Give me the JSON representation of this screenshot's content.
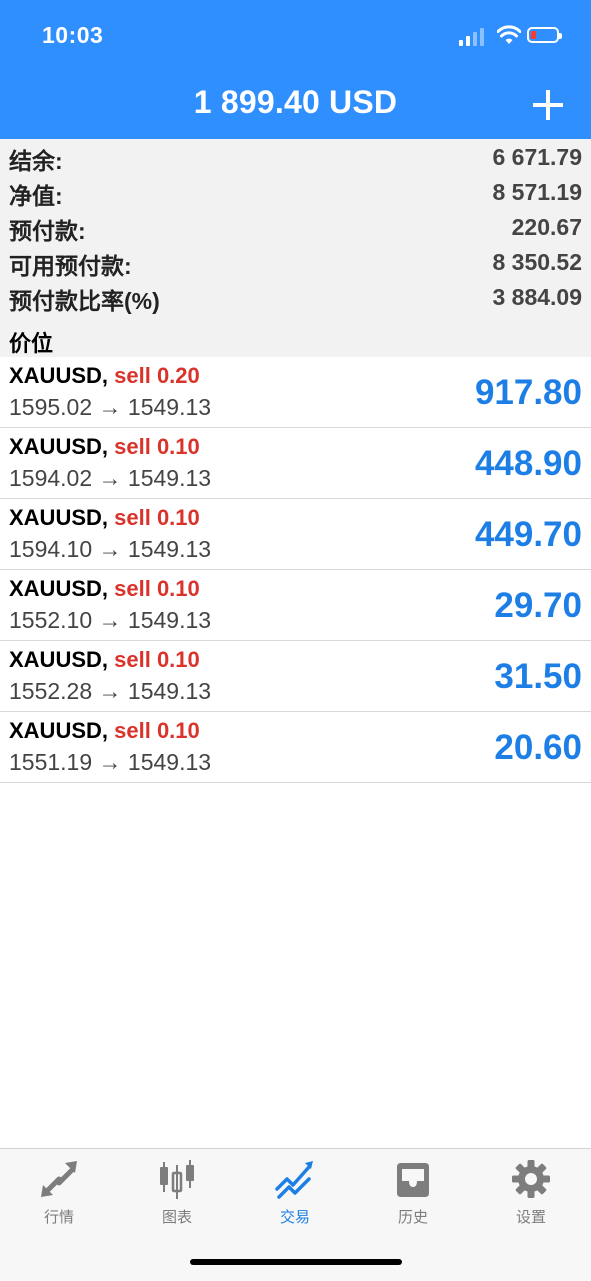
{
  "status_bar": {
    "time": "10:03"
  },
  "header": {
    "title": "1 899.40 USD"
  },
  "summary": [
    {
      "label": "结余:",
      "value": "6 671.79"
    },
    {
      "label": "净值:",
      "value": "8 571.19"
    },
    {
      "label": "预付款:",
      "value": "220.67"
    },
    {
      "label": "可用预付款:",
      "value": "8 350.52"
    },
    {
      "label": "预付款比率(%)",
      "value": "3 884.09"
    }
  ],
  "section_title": "价位",
  "positions": [
    {
      "symbol": "XAUUSD,",
      "side": "sell 0.20",
      "prices": "1595.02 → 1549.13",
      "profit": "917.80"
    },
    {
      "symbol": "XAUUSD,",
      "side": "sell 0.10",
      "prices": "1594.02 → 1549.13",
      "profit": "448.90"
    },
    {
      "symbol": "XAUUSD,",
      "side": "sell 0.10",
      "prices": "1594.10 → 1549.13",
      "profit": "449.70"
    },
    {
      "symbol": "XAUUSD,",
      "side": "sell 0.10",
      "prices": "1552.10 → 1549.13",
      "profit": "29.70"
    },
    {
      "symbol": "XAUUSD,",
      "side": "sell 0.10",
      "prices": "1552.28 → 1549.13",
      "profit": "31.50"
    },
    {
      "symbol": "XAUUSD,",
      "side": "sell 0.10",
      "prices": "1551.19 → 1549.13",
      "profit": "20.60"
    }
  ],
  "tabs": [
    {
      "label": "行情",
      "icon": "quotes-arrows-icon"
    },
    {
      "label": "图表",
      "icon": "candlestick-chart-icon"
    },
    {
      "label": "交易",
      "icon": "trade-trend-icon",
      "active": true
    },
    {
      "label": "历史",
      "icon": "history-inbox-icon"
    },
    {
      "label": "设置",
      "icon": "gear-icon"
    }
  ],
  "colors": {
    "header_bg": "#2f8fff",
    "sell": "#d9332b",
    "profit": "#1d7fe6",
    "tab_active": "#1d7fe6",
    "tab_inactive": "#7d7d7d"
  }
}
